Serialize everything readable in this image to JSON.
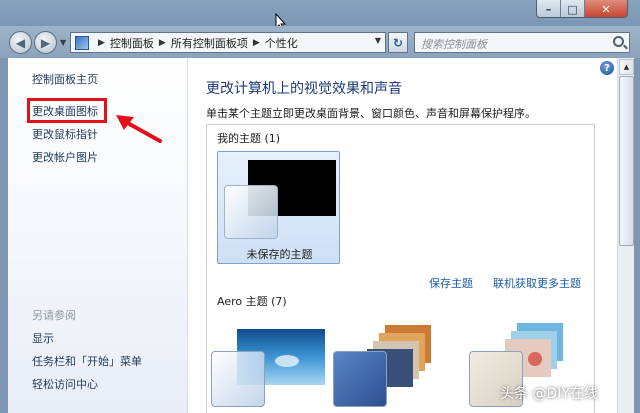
{
  "window": {
    "controls": {
      "minimize": "–",
      "maximize": "□",
      "close": "✕"
    }
  },
  "navbar": {
    "back": "◀",
    "forward": "▶",
    "breadcrumbs": [
      "控制面板",
      "所有控制面板项",
      "个性化"
    ],
    "refresh": "↻",
    "search_placeholder": "搜索控制面板"
  },
  "sidebar": {
    "home": "控制面板主页",
    "items": [
      "更改桌面图标",
      "更改鼠标指针",
      "更改帐户图片"
    ],
    "see_also_heading": "另请参阅",
    "see_also": [
      "显示",
      "任务栏和「开始」菜单",
      "轻松访问中心"
    ]
  },
  "main": {
    "help": "?",
    "title": "更改计算机上的视觉效果和声音",
    "description": "单击某个主题立即更改桌面背景、窗口颜色、声音和屏幕保护程序。",
    "my_themes_label": "我的主题 (1)",
    "unsaved_theme": "未保存的主题",
    "save_theme": "保存主题",
    "get_more_themes": "联机获取更多主题",
    "aero_label": "Aero 主题 (7)"
  },
  "watermark": "头条 @DIY在线",
  "colors": {
    "highlight": "#e3101a",
    "link": "#1c5ba8",
    "title": "#1e3a7a"
  }
}
